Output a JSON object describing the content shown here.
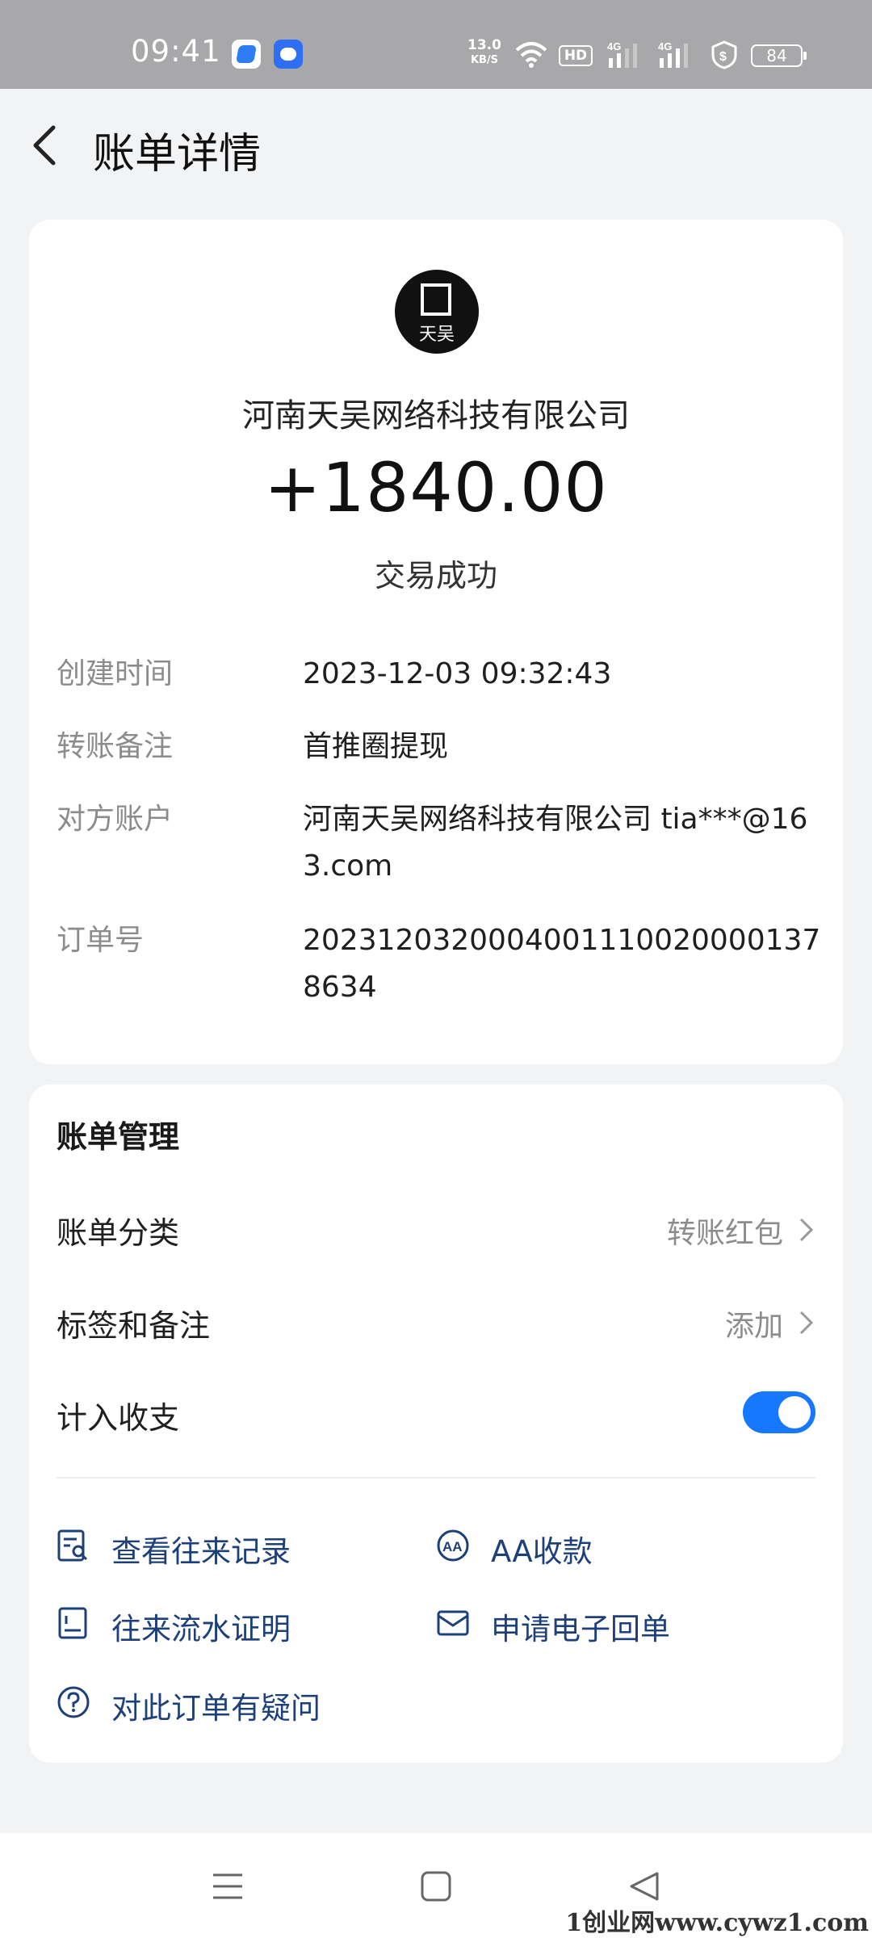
{
  "status_bar": {
    "time": "09:41",
    "net_speed_value": "13.0",
    "net_speed_unit": "KB/S",
    "hd_label": "HD",
    "signal1_label": "4G",
    "signal2_label": "4G",
    "battery": "84"
  },
  "header": {
    "title": "账单详情"
  },
  "transaction": {
    "merchant_logo_text": "天吴",
    "merchant": "河南天吴网络科技有限公司",
    "amount": "+1840.00",
    "status": "交易成功",
    "details": [
      {
        "label": "创建时间",
        "value": "2023-12-03 09:32:43"
      },
      {
        "label": "转账备注",
        "value": "首推圈提现"
      },
      {
        "label": "对方账户",
        "value": "河南天吴网络科技有限公司 tia***@163.com"
      },
      {
        "label": "订单号",
        "value": "20231203200040011100200001378634"
      }
    ]
  },
  "management": {
    "title": "账单管理",
    "category": {
      "label": "账单分类",
      "value": "转账红包"
    },
    "tags": {
      "label": "标签和备注",
      "value": "添加"
    },
    "count_in": {
      "label": "计入收支",
      "enabled": true
    },
    "actions": {
      "records": "查看往来记录",
      "aa": "AA收款",
      "statement": "往来流水证明",
      "receipt": "申请电子回单",
      "question": "对此订单有疑问"
    }
  },
  "watermark": "1创业网www.cywz1.com",
  "colors": {
    "accent": "#1677ff",
    "link": "#1d3f7a",
    "muted": "#8c8c8c",
    "background": "#f2f3f5"
  }
}
